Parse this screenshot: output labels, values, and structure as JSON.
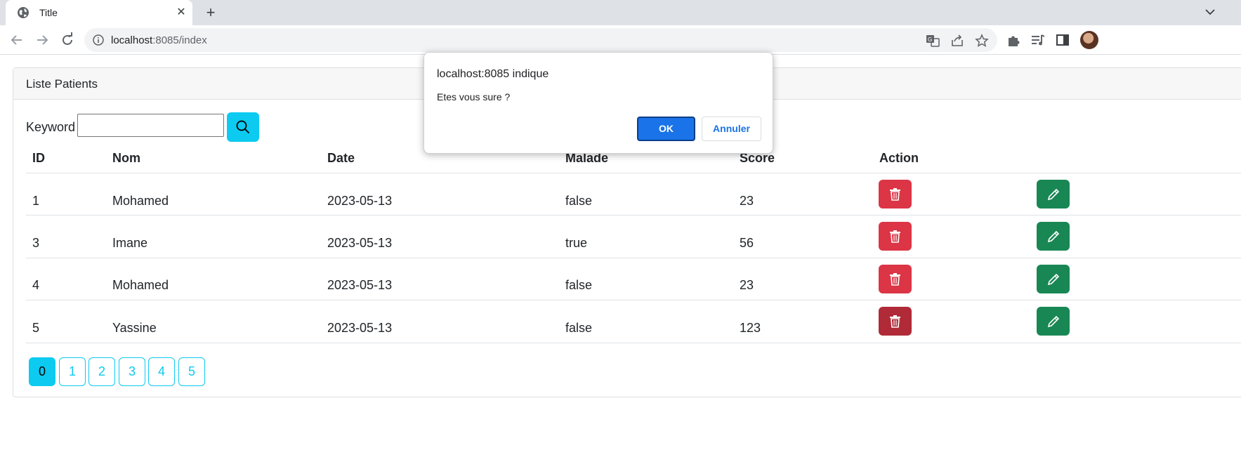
{
  "browser": {
    "tab_title": "Title",
    "new_tab_label": "+",
    "close_label": "✕",
    "url_host": "localhost",
    "url_path": ":8085/index"
  },
  "card": {
    "title": "Liste Patients",
    "keyword_label": "Keyword",
    "keyword_value": ""
  },
  "table": {
    "headers": [
      "ID",
      "Nom",
      "Date",
      "Malade",
      "Score",
      "Action"
    ],
    "rows": [
      {
        "id": "1",
        "nom": "Mohamed",
        "date": "2023-05-13",
        "malade": "false",
        "score": "23"
      },
      {
        "id": "3",
        "nom": "Imane",
        "date": "2023-05-13",
        "malade": "true",
        "score": "56"
      },
      {
        "id": "4",
        "nom": "Mohamed",
        "date": "2023-05-13",
        "malade": "false",
        "score": "23"
      },
      {
        "id": "5",
        "nom": "Yassine",
        "date": "2023-05-13",
        "malade": "false",
        "score": "123"
      }
    ]
  },
  "pagination": {
    "pages": [
      "0",
      "1",
      "2",
      "3",
      "4",
      "5"
    ],
    "current": "0"
  },
  "dialog": {
    "title": "localhost:8085 indique",
    "message": "Etes vous sure ?",
    "ok_label": "OK",
    "cancel_label": "Annuler"
  },
  "colors": {
    "info": "#0dcaf0",
    "danger": "#dc3545",
    "success": "#198754",
    "chrome_primary": "#1a73e8"
  }
}
